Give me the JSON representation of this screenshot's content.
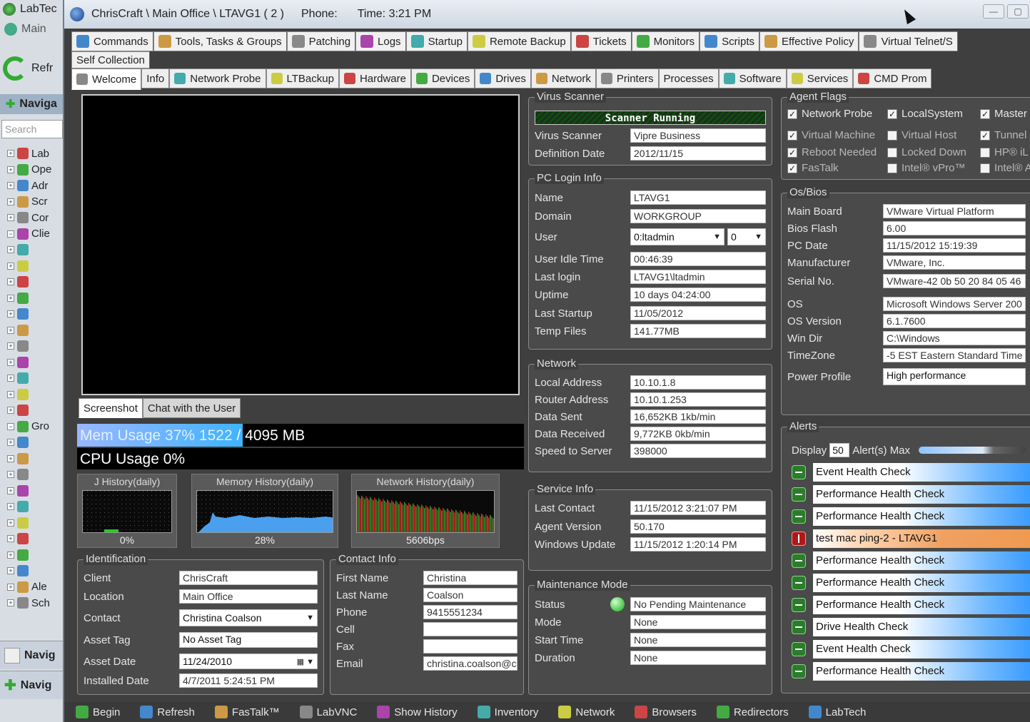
{
  "bg_app": {
    "title": "LabTec",
    "main_label": "Main",
    "refresh_label": "Refr",
    "nav_label": "Naviga",
    "search_placeholder": "Search",
    "tree": [
      "Lab",
      "Ope",
      "Adr",
      "Scr",
      "Cor",
      "Clie",
      "",
      "",
      "",
      "",
      "",
      "",
      "",
      "",
      "",
      "",
      "",
      "Gro",
      "",
      "",
      "",
      "",
      "",
      "",
      "",
      "",
      "",
      "Ale",
      "Sch"
    ],
    "nav_btn_1": "Navig",
    "nav_btn_2": "Navig"
  },
  "window": {
    "title": "ChrisCraft \\ Main Office \\ LTAVG1 ( 2 )",
    "phone_label": "Phone:",
    "time_label": "Time: 3:21 PM"
  },
  "toolbar": {
    "items": [
      "Commands",
      "Tools, Tasks & Groups",
      "Patching",
      "Logs",
      "Startup",
      "Remote Backup",
      "Tickets",
      "Monitors",
      "Scripts",
      "Effective Policy",
      "Virtual Telnet/S"
    ],
    "self_collection": "Self Collection"
  },
  "tabs": [
    "Welcome",
    "Info",
    "Network Probe",
    "LTBackup",
    "Hardware",
    "Devices",
    "Drives",
    "Network",
    "Printers",
    "Processes",
    "Software",
    "Services",
    "CMD Prom"
  ],
  "screenshot": {
    "tab_screenshot": "Screenshot",
    "tab_chat": "Chat with the User"
  },
  "usage": {
    "mem_label": "Mem Usage 37% 1522",
    "mem_total": "/ 4095 MB",
    "mem_percent": 37,
    "cpu_label": "CPU Usage 0%"
  },
  "history": {
    "cpu_title": "J History(daily)",
    "cpu_value": "0%",
    "mem_title": "Memory History(daily)",
    "mem_value": "28%",
    "net_title": "Network History(daily)",
    "net_value": "5606bps"
  },
  "identification": {
    "legend": "Identification",
    "client_label": "Client",
    "client": "ChrisCraft",
    "location_label": "Location",
    "location": "Main Office",
    "contact_label": "Contact",
    "contact": "Christina Coalson",
    "asset_tag_label": "Asset Tag",
    "asset_tag": "No Asset Tag",
    "asset_date_label": "Asset Date",
    "asset_date": "11/24/2010",
    "installed_date_label": "Installed Date",
    "installed_date": "4/7/2011 5:24:51 PM"
  },
  "contact_info": {
    "legend": "Contact Info",
    "first_name_label": "First Name",
    "first_name": "Christina",
    "last_name_label": "Last Name",
    "last_name": "Coalson",
    "phone_label": "Phone",
    "phone": "9415551234",
    "cell_label": "Cell",
    "cell": "",
    "fax_label": "Fax",
    "fax": "",
    "email_label": "Email",
    "email": "christina.coalson@c"
  },
  "virus": {
    "legend": "Virus Scanner",
    "status": "Scanner Running",
    "scanner_label": "Virus Scanner",
    "scanner": "Vipre Business",
    "def_date_label": "Definition Date",
    "def_date": "2012/11/15"
  },
  "login": {
    "legend": "PC Login Info",
    "name_label": "Name",
    "name": "LTAVG1",
    "domain_label": "Domain",
    "domain": "WORKGROUP",
    "user_label": "User",
    "user": "0:ltadmin",
    "user_session": "0",
    "idle_label": "User Idle Time",
    "idle": "00:46:39",
    "last_login_label": "Last login",
    "last_login": "LTAVG1\\ltadmin",
    "uptime_label": "Uptime",
    "uptime": "10 days 04:24:00",
    "last_startup_label": "Last Startup",
    "last_startup": "11/05/2012",
    "temp_label": "Temp Files",
    "temp": "141.77MB"
  },
  "network": {
    "legend": "Network",
    "local_label": "Local Address",
    "local": "10.10.1.8",
    "router_label": "Router Address",
    "router": "10.10.1.253",
    "sent_label": "Data Sent",
    "sent": "16,652KB  1kb/min",
    "recv_label": "Data Received",
    "recv": "9,772KB  0kb/min",
    "speed_label": "Speed to Server",
    "speed": "398000"
  },
  "service": {
    "legend": "Service Info",
    "last_contact_label": "Last Contact",
    "last_contact": "11/15/2012 3:21:07 PM",
    "agent_label": "Agent Version",
    "agent": "50.170",
    "wu_label": "Windows Update",
    "wu": "11/15/2012 1:20:14 PM"
  },
  "maintenance": {
    "legend": "Maintenance Mode",
    "status_label": "Status",
    "status": "No Pending Maintenance",
    "mode_label": "Mode",
    "mode": "None",
    "start_label": "Start Time",
    "start": "None",
    "duration_label": "Duration",
    "duration": "None"
  },
  "agent_flags": {
    "legend": "Agent Flags",
    "flags": [
      {
        "label": "Network Probe",
        "checked": true,
        "active": true
      },
      {
        "label": "LocalSystem",
        "checked": true,
        "active": true
      },
      {
        "label": "Master",
        "checked": true,
        "active": true
      },
      {
        "label": "Virtual Machine",
        "checked": true,
        "active": false
      },
      {
        "label": "Virtual Host",
        "checked": false,
        "active": false
      },
      {
        "label": "Tunnel",
        "checked": true,
        "active": false
      },
      {
        "label": "Reboot Needed",
        "checked": true,
        "active": false
      },
      {
        "label": "Locked Down",
        "checked": false,
        "active": false
      },
      {
        "label": "HP® iL",
        "checked": false,
        "active": false
      },
      {
        "label": "FasTalk",
        "checked": true,
        "active": false
      },
      {
        "label": "Intel® vPro™",
        "checked": false,
        "active": false
      },
      {
        "label": "Intel® A",
        "checked": false,
        "active": false
      }
    ]
  },
  "os_bios": {
    "legend": "Os/Bios",
    "board_label": "Main Board",
    "board": "VMware Virtual Platform",
    "bios_label": "Bios Flash",
    "bios": "6.00",
    "pcdate_label": "PC Date",
    "pcdate": "11/15/2012 15:19:39",
    "mfr_label": "Manufacturer",
    "mfr": "VMware, Inc.",
    "serial_label": "Serial No.",
    "serial": "VMware-42 0b 50 20 84 05 46",
    "os_label": "OS",
    "os": "Microsoft Windows Server 200",
    "osver_label": "OS Version",
    "osver": "6.1.7600",
    "windir_label": "Win Dir",
    "windir": "C:\\Windows",
    "tz_label": "TimeZone",
    "tz": "-5 EST Eastern Standard Time",
    "power_label": "Power Profile",
    "power": "High performance"
  },
  "alerts": {
    "legend": "Alerts",
    "display_label": "Display",
    "display_count": "50",
    "max_label": "Alert(s) Max",
    "items": [
      {
        "text": "Event Health Check",
        "error": false
      },
      {
        "text": "Performance Health Check",
        "error": false
      },
      {
        "text": "Performance Health Check",
        "error": false
      },
      {
        "text": "test mac ping-2 - LTAVG1",
        "error": true
      },
      {
        "text": "Performance Health Check",
        "error": false
      },
      {
        "text": "Performance Health Check",
        "error": false
      },
      {
        "text": "Performance Health Check",
        "error": false
      },
      {
        "text": "Drive Health Check",
        "error": false
      },
      {
        "text": "Event Health Check",
        "error": false
      },
      {
        "text": "Performance Health Check",
        "error": false
      }
    ]
  },
  "bottom": [
    "Begin",
    "Refresh",
    "FasTalk™",
    "LabVNC",
    "Show History",
    "Inventory",
    "Network",
    "Browsers",
    "Redirectors",
    "LabTech"
  ]
}
